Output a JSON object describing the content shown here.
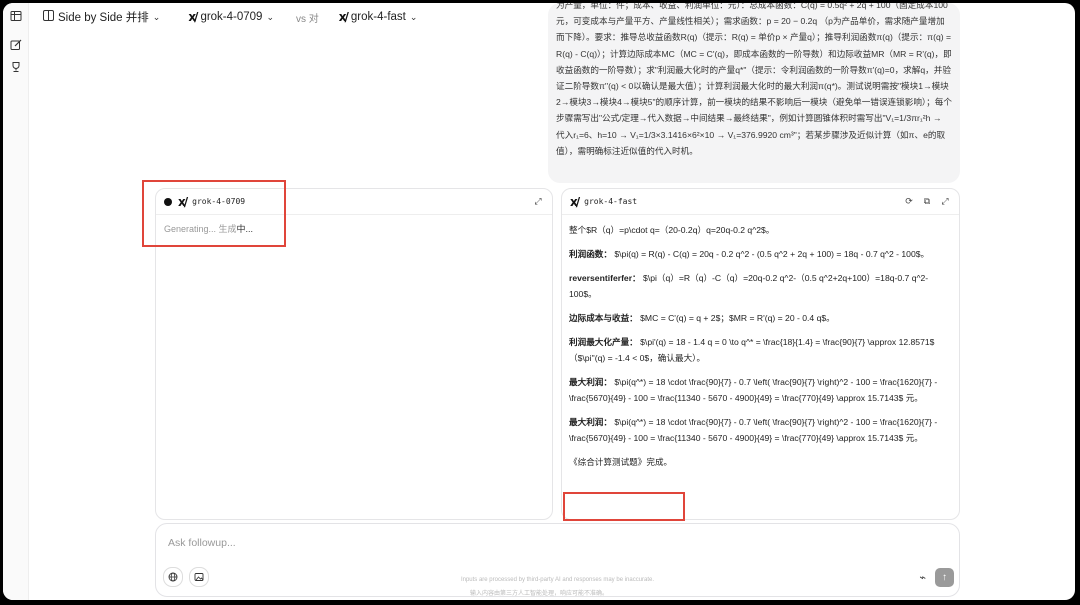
{
  "topbar": {
    "mode_label": "Side by Side 并排",
    "model_a": "grok-4-0709",
    "vs_label": "vs 对",
    "model_b": "grok-4-fast"
  },
  "rail": {
    "icons": [
      "table-icon",
      "edit-icon",
      "trophy-icon"
    ]
  },
  "user_message": "为产量，单位：件；成本、收益、利润单位：元）：总成本函数：C(q) = 0.5q² + 2q + 100（固定成本100元，可变成本与产量平方、产量线性相关）；需求函数：p = 20 − 0.2q （p为产品单价，需求随产量增加而下降）。要求：推导总收益函数R(q)（提示：R(q) = 单价p × 产量q）；推导利润函数π(q)（提示：π(q) = R(q) - C(q)）；计算边际成本MC（MC = C'(q)，即成本函数的一阶导数）和边际收益MR（MR = R'(q)，即收益函数的一阶导数）；求\"利润最大化时的产量q*\"（提示：令利润函数的一阶导数π'(q)=0，求解q，并验证二阶导数π''(q) < 0以确认是最大值）；计算利润最大化时的最大利润π(q*)。测试说明需按\"模块1→模块2→模块3→模块4→模块5\"的顺序计算，前一模块的结果不影响后一模块（避免单一错误连锁影响）；每个步骤需写出\"公式/定理→代入数据→中间结果→最终结果\"，例如计算圆锥体积时需写出\"V₁=1/3πr₁²h → 代入r₁=6、h=10 → V₁=1/3×3.1416×6²×10 → V₁=376.9920 cm³\"；若某步骤涉及近似计算（如π、e的取值），需明确标注近似值的代入时机。",
  "panel_a": {
    "model": "grok-4-0709",
    "status": "Generating...",
    "status_cn_1": " 生成",
    "status_cn_2": "中..."
  },
  "panel_b": {
    "model": "grok-4-fast",
    "paragraphs": [
      {
        "label": "",
        "text": "整个$R（q）=p\\cdot q=（20-0.2q）q=20q-0.2 q^2$。"
      },
      {
        "label": "利润函数：",
        "text": "$\\pi(q) = R(q) - C(q) = 20q - 0.2 q^2 - (0.5 q^2 + 2q + 100) = 18q - 0.7 q^2 - 100$。"
      },
      {
        "label": "reversentiferfer：",
        "text": "$\\pi（q）=R（q）-C（q）=20q-0.2 q^2-（0.5 q^2+2q+100）=18q-0.7 q^2-100$。"
      },
      {
        "label": "边际成本与收益：",
        "text": "$MC = C'(q) = q + 2$；$MR = R'(q) = 20 - 0.4 q$。"
      },
      {
        "label": "利润最大化产量：",
        "text": "$\\pi'(q) = 18 - 1.4 q = 0 \\to q^* = \\frac{18}{1.4} = \\frac{90}{7} \\approx 12.8571$（$\\pi''(q) = -1.4 < 0$，确认最大）。"
      },
      {
        "label": "最大利润：",
        "text": "$\\pi(q^*) = 18 \\cdot \\frac{90}{7} - 0.7 \\left( \\frac{90}{7} \\right)^2 - 100 = \\frac{1620}{7} - \\frac{5670}{49} - 100 = \\frac{11340 - 5670 - 4900}{49} = \\frac{770}{49} \\approx 15.7143$ 元。"
      },
      {
        "label": "最大利润：",
        "text": "$\\pi(q^*) = 18 \\cdot \\frac{90}{7} - 0.7 \\left( \\frac{90}{7} \\right)^2 - 100 = \\frac{1620}{7} - \\frac{5670}{49} - 100 = \\frac{11340 - 5670 - 4900}{49} = \\frac{770}{49} \\approx 15.7143$ 元。"
      }
    ],
    "done": "《综合计算测试题》完成。"
  },
  "composer": {
    "placeholder": "Ask followup...",
    "disclaimer_en": "Inputs are processed by third-party AI and responses may be inaccurate.",
    "disclaimer_cn": "输入内容由第三方人工智能处理，响应可能不准确。"
  },
  "colors": {
    "highlight_box": "#e0453a",
    "send_button": "#9a9a9a"
  }
}
